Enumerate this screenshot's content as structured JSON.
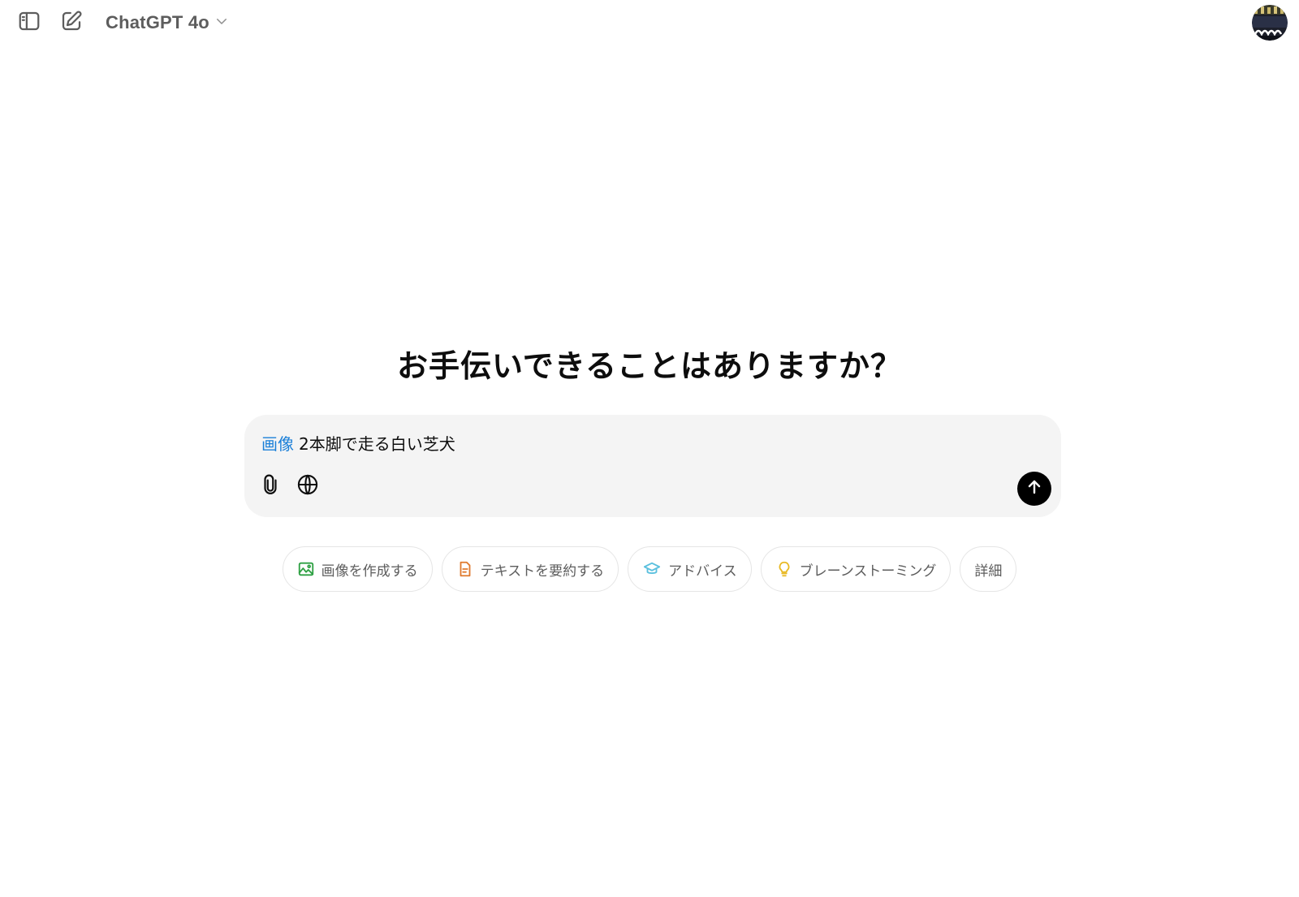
{
  "header": {
    "model_name": "ChatGPT 4o",
    "icons": {
      "sidebar": "sidebar-toggle-icon",
      "new_chat": "compose-icon",
      "model_dropdown": "chevron-down-icon"
    }
  },
  "main": {
    "headline": "お手伝いできることはありますか？"
  },
  "composer": {
    "tag": "画像",
    "prompt_text": "2本脚で走る白い芝犬",
    "tag_color": "#1a7fd8",
    "send_color": "#000000"
  },
  "suggestions": [
    {
      "label": "画像を作成する",
      "icon": "image-icon",
      "color": "#2ea043"
    },
    {
      "label": "テキストを要約する",
      "icon": "document-icon",
      "color": "#e07a2e"
    },
    {
      "label": "アドバイス",
      "icon": "graduation-cap-icon",
      "color": "#5bc0de"
    },
    {
      "label": "ブレーンストーミング",
      "icon": "lightbulb-icon",
      "color": "#e8b923"
    },
    {
      "label": "詳細"
    }
  ]
}
